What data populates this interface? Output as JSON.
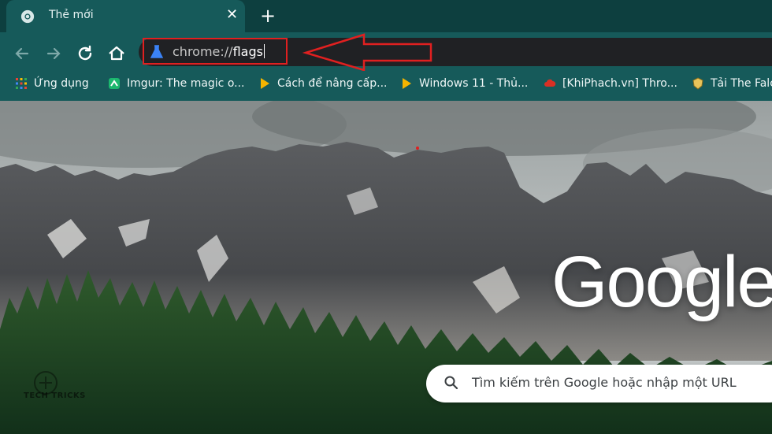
{
  "tab": {
    "title": "Thẻ mới",
    "close_glyph": "✕"
  },
  "new_tab_glyph": "+",
  "nav": {
    "back_icon": "arrow-left-icon",
    "forward_icon": "arrow-right-icon",
    "reload_icon": "reload-icon",
    "home_icon": "home-icon"
  },
  "omnibox": {
    "prefix": "chrome://",
    "bold": "flags"
  },
  "bookmarks": [
    {
      "label": "Ứng dụng",
      "icon": "apps-grid-icon"
    },
    {
      "label": "Imgur: The magic o...",
      "icon": "imgur-icon"
    },
    {
      "label": "Cách để nâng cấp...",
      "icon": "play-triangle-icon"
    },
    {
      "label": "Windows 11 - Thủ...",
      "icon": "play-triangle-icon"
    },
    {
      "label": "[KhiPhach.vn] Thro...",
      "icon": "cloud-icon"
    },
    {
      "label": "Tải The Falc",
      "icon": "crest-icon"
    }
  ],
  "logo": "Google",
  "search": {
    "placeholder": "Tìm kiếm trên Google hoặc nhập một URL"
  },
  "watermark": "TECH TRICKS",
  "colors": {
    "toolbar": "#165a5a",
    "tabstrip": "#0d3f3f",
    "annotation": "#e02020"
  }
}
